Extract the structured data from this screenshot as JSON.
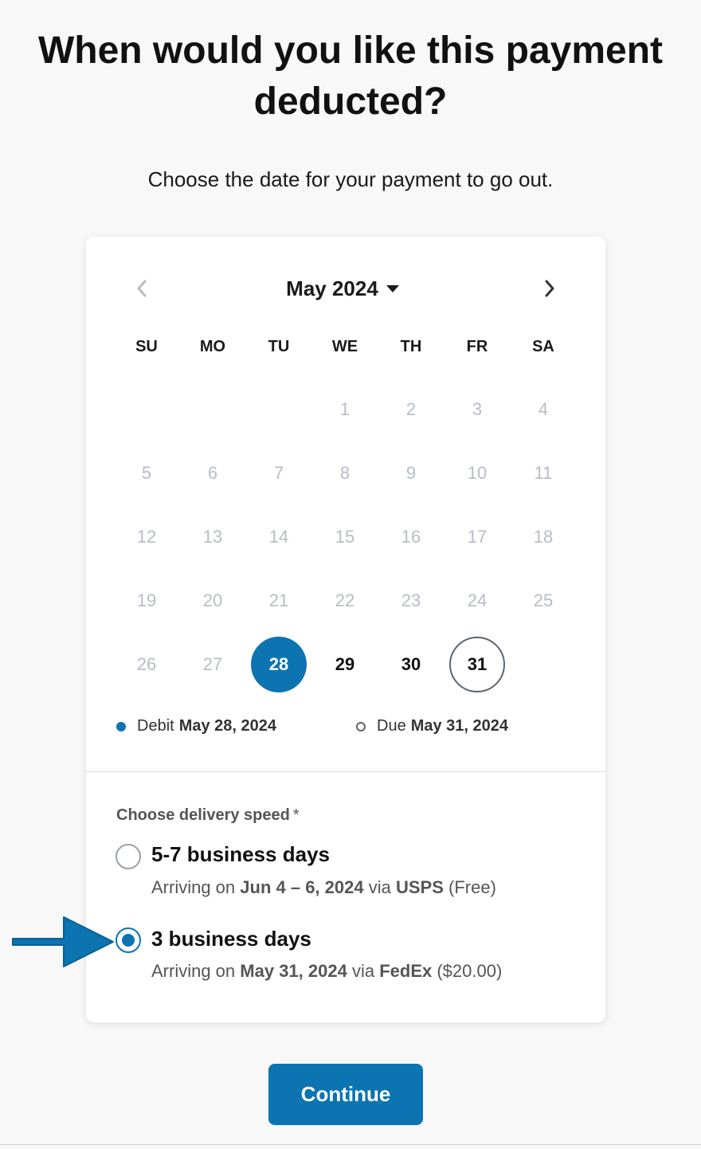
{
  "page": {
    "title": "When would you like this payment deducted?",
    "subtitle": "Choose the date for your payment to go out."
  },
  "calendar": {
    "month_label": "May 2024",
    "weekdays": [
      "SU",
      "MO",
      "TU",
      "WE",
      "TH",
      "FR",
      "SA"
    ],
    "first_weekday_index": 3,
    "days_in_month": 31,
    "selected_day": 28,
    "due_day": 31,
    "enabled_days": [
      28,
      29,
      30,
      31
    ]
  },
  "legend": {
    "debit_label": "Debit",
    "debit_date": "May 28, 2024",
    "due_label": "Due",
    "due_date": "May 31, 2024"
  },
  "delivery": {
    "label": "Choose delivery speed",
    "required_mark": "*",
    "options": [
      {
        "title": "5-7 business days",
        "prefix": "Arriving on",
        "dates": "Jun 4 – 6, 2024",
        "via": "via",
        "carrier": "USPS",
        "price": "(Free)",
        "checked": false
      },
      {
        "title": "3 business days",
        "prefix": "Arriving on",
        "dates": "May 31, 2024",
        "via": "via",
        "carrier": "FedEx",
        "price": "($20.00)",
        "checked": true
      }
    ]
  },
  "actions": {
    "continue_label": "Continue"
  },
  "colors": {
    "accent": "#0b74b1",
    "disabled_day": "#b8bcc4",
    "due_ring": "#5c6470"
  }
}
